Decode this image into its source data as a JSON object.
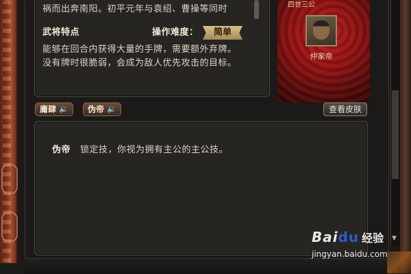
{
  "bio": {
    "line1": "祸而出奔南阳。初平元年与袁绍、曹操等同时"
  },
  "features": {
    "heading": "武将特点",
    "difficulty_label": "操作难度：",
    "difficulty_value": "简单",
    "line1": "能够在回合内获得大量的手牌，需要额外弃牌。",
    "line2": "没有牌时很脆弱，会成为敌人优先攻击的目标。"
  },
  "portrait": {
    "title": "四世三公",
    "name": "仲家帝"
  },
  "skills": {
    "skill1_label": "庸肆",
    "skill2_label": "伪帝",
    "skin_button": "查看皮肤"
  },
  "skill_detail": {
    "name": "伪帝",
    "description": "锁定技，你视为拥有主公的主公技。"
  },
  "watermark": {
    "logo_a": "Bai",
    "logo_b": "du",
    "cn": "经验",
    "url": "jingyan.baidu.com"
  },
  "icons": {
    "speaker": "speaker-icon",
    "scroll_down": "chevron-down-icon"
  },
  "colors": {
    "text": "#dcd6c6",
    "badge": "#c8ab6c",
    "portrait_bg": "#8c1414",
    "panel": "#262522"
  }
}
